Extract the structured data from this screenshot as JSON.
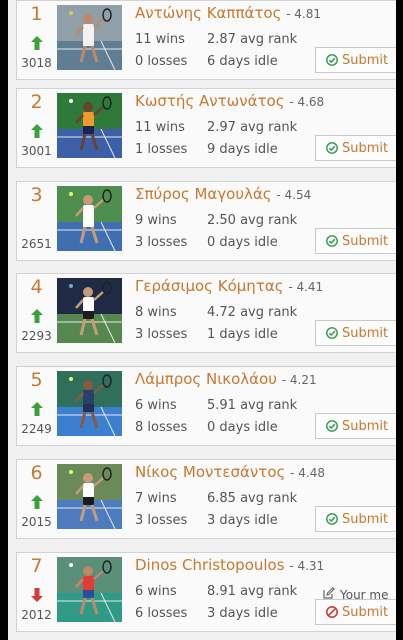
{
  "players": [
    {
      "rank": "1",
      "rating": "3018",
      "trend": "up",
      "name": "Αντώνης Καππάτος",
      "score": "- 4.81",
      "wins": "11 wins",
      "losses": "0 losses",
      "avg_rank": "2.87 avg rank",
      "idle": "6 days idle",
      "action": "Submit",
      "action_icon": "check-circle-icon"
    },
    {
      "rank": "2",
      "rating": "3001",
      "trend": "up",
      "name": "Κωστής Αντωνάτος",
      "score": "- 4.68",
      "wins": "11 wins",
      "losses": "1 losses",
      "avg_rank": "2.97 avg rank",
      "idle": "9 days idle",
      "action": "Submit",
      "action_icon": "check-circle-icon"
    },
    {
      "rank": "3",
      "rating": "2651",
      "trend": "none",
      "name": "Σπύρος Μαγουλάς",
      "score": "- 4.54",
      "wins": "9 wins",
      "losses": "3 losses",
      "avg_rank": "2.50 avg rank",
      "idle": "0 days idle",
      "action": "Submit",
      "action_icon": "check-circle-icon"
    },
    {
      "rank": "4",
      "rating": "2293",
      "trend": "up",
      "name": "Γεράσιμος Κόμητας",
      "score": "- 4.41",
      "wins": "8 wins",
      "losses": "3 losses",
      "avg_rank": "4.72 avg rank",
      "idle": "1 days idle",
      "action": "Submit",
      "action_icon": "check-circle-icon"
    },
    {
      "rank": "5",
      "rating": "2249",
      "trend": "up",
      "name": "Λάμπρος Νικολάου",
      "score": "- 4.21",
      "wins": "6 wins",
      "losses": "8 losses",
      "avg_rank": "5.91 avg rank",
      "idle": "0 days idle",
      "action": "Submit",
      "action_icon": "check-circle-icon"
    },
    {
      "rank": "6",
      "rating": "2015",
      "trend": "up",
      "name": "Νίκος Μοντεσάντος",
      "score": "- 4.48",
      "wins": "7 wins",
      "losses": "3 losses",
      "avg_rank": "6.85 avg rank",
      "idle": "3 days idle",
      "action": "Submit",
      "action_icon": "check-circle-icon"
    },
    {
      "rank": "7",
      "rating": "2012",
      "trend": "down",
      "name": "Dinos Christopoulos",
      "score": "- 4.31",
      "wins": "6 wins",
      "losses": "6 losses",
      "avg_rank": "8.91 avg rank",
      "idle": "3 days idle",
      "action": "Submit",
      "action_icon": "ban-icon",
      "note": "Your me",
      "note_icon": "edit-icon"
    }
  ],
  "colors": {
    "accent": "#c8782f",
    "trend_up": "#3aa13a",
    "trend_down": "#d23a3a",
    "submit_ok": "#2f9c4b",
    "submit_blocked": "#d23a3a"
  }
}
